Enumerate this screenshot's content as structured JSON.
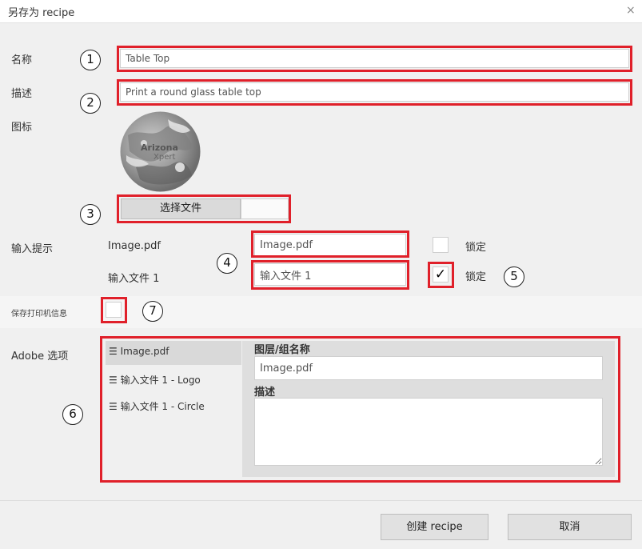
{
  "dialog": {
    "title": "另存为 recipe",
    "close_glyph": "×"
  },
  "fields": {
    "name_label": "名称",
    "name_value": "Table Top",
    "desc_label": "描述",
    "desc_value": "Print a round glass table top",
    "icon_label": "图标",
    "icon_text_line1": "Arizona",
    "icon_text_line2": "Xpert",
    "choose_file_label": "选择文件"
  },
  "input_hints": {
    "label": "输入提示",
    "rows": [
      {
        "name": "Image.pdf",
        "value": "Image.pdf",
        "lock_label": "锁定",
        "locked": false
      },
      {
        "name": "输入文件 1",
        "value": "输入文件 1",
        "lock_label": "锁定",
        "locked": true
      }
    ],
    "check_glyph": "✓"
  },
  "save_printer": {
    "label": "保存打印机信息",
    "checked": false
  },
  "adobe": {
    "label": "Adobe 选项",
    "layers": [
      {
        "label": "Image.pdf",
        "selected": true
      },
      {
        "label": "输入文件 1 - Logo",
        "selected": false
      },
      {
        "label": "输入文件 1 - Circle",
        "selected": false
      }
    ],
    "menu_glyph": "☰",
    "layer_name_label": "图层/组名称",
    "layer_name_value": "Image.pdf",
    "desc_label": "描述",
    "desc_value": ""
  },
  "annotations": [
    "1",
    "2",
    "3",
    "4",
    "5",
    "6",
    "7"
  ],
  "footer": {
    "create_label": "创建 recipe",
    "cancel_label": "取消"
  },
  "colors": {
    "highlight": "#e0202a",
    "dialog_bg": "#f0f0f0"
  }
}
